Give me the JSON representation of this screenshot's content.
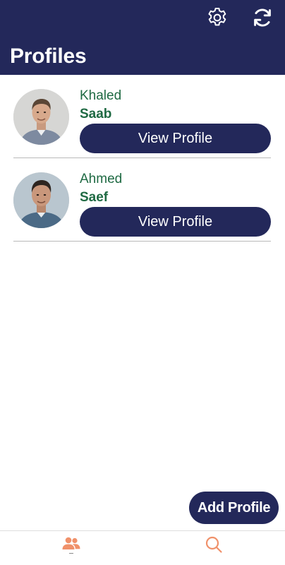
{
  "header": {
    "title": "Profiles",
    "settings_icon": "gear-icon",
    "refresh_icon": "refresh-icon",
    "background_color": "#23285a"
  },
  "profiles": [
    {
      "first_name": "Khaled",
      "last_name": "Saab",
      "button_label": "View Profile"
    },
    {
      "first_name": "Ahmed",
      "last_name": "Saef",
      "button_label": "View Profile"
    }
  ],
  "add_button": {
    "label": "Add Profile"
  },
  "bottom_nav": {
    "items": [
      {
        "icon": "people-icon",
        "active": true,
        "color": "#f0916a"
      },
      {
        "icon": "search-icon",
        "active": false,
        "color": "#f0916a"
      }
    ]
  },
  "colors": {
    "primary": "#23285a",
    "name_text": "#1f6a43",
    "accent": "#f0916a"
  }
}
